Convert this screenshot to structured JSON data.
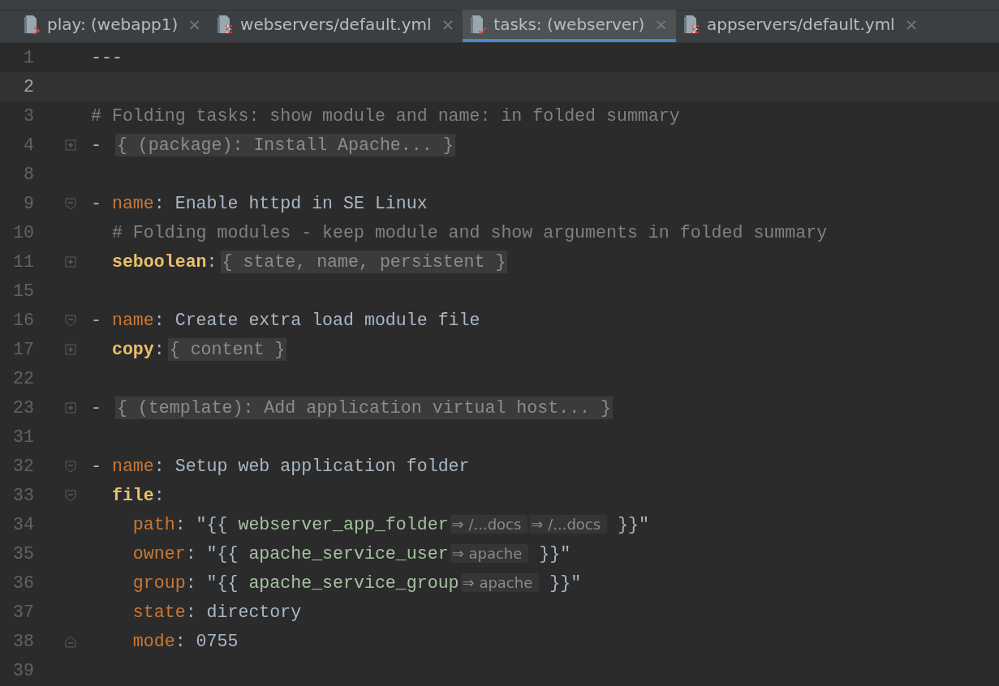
{
  "tabs": [
    {
      "label": "play: (webapp1)",
      "kind": "playbook",
      "close": "×",
      "selected": false
    },
    {
      "label": "webservers/default.yml",
      "kind": "vars",
      "close": "×",
      "selected": false
    },
    {
      "label": "tasks: (webserver)",
      "kind": "tasks",
      "close": "×",
      "selected": true
    },
    {
      "label": "appservers/default.yml",
      "kind": "vars",
      "close": "×",
      "selected": false
    }
  ],
  "editor": {
    "lines": [
      {
        "number": "1",
        "kind": "plain",
        "current": false,
        "tokens": [
          {
            "kind": "punct",
            "text": "---"
          }
        ]
      },
      {
        "number": "2",
        "kind": "plain",
        "current": true
      },
      {
        "number": "3",
        "kind": "plain",
        "current": false,
        "tokens": [
          {
            "kind": "comment",
            "text": "# Folding tasks: show module and name: in folded summary"
          }
        ]
      },
      {
        "number": "4",
        "kind": "collapsed",
        "current": false,
        "tokens": [
          {
            "kind": "punct",
            "text": "- "
          },
          {
            "kind": "folded",
            "text": "{ (package): Install Apache... }"
          }
        ]
      },
      {
        "number": "8",
        "kind": "plain",
        "current": false
      },
      {
        "number": "9",
        "kind": "region-start",
        "current": false,
        "tokens": [
          {
            "kind": "punct",
            "text": "- "
          },
          {
            "kind": "key",
            "text": "name"
          },
          {
            "kind": "punct",
            "text": ": "
          },
          {
            "kind": "value",
            "text": "Enable httpd in SE Linux"
          }
        ]
      },
      {
        "number": "10",
        "kind": "plain",
        "current": false,
        "tokens": [
          {
            "kind": "comment",
            "text": "  # Folding modules - keep module and show arguments in folded summary"
          }
        ]
      },
      {
        "number": "11",
        "kind": "collapsed",
        "current": false,
        "tokens": [
          {
            "kind": "module",
            "text": "  seboolean"
          },
          {
            "kind": "punct",
            "text": ":"
          },
          {
            "kind": "folded",
            "text": "{ state, name, persistent }"
          }
        ]
      },
      {
        "number": "15",
        "kind": "plain",
        "current": false
      },
      {
        "number": "16",
        "kind": "region-start",
        "current": false,
        "tokens": [
          {
            "kind": "punct",
            "text": "- "
          },
          {
            "kind": "key",
            "text": "name"
          },
          {
            "kind": "punct",
            "text": ": "
          },
          {
            "kind": "value",
            "text": "Create extra load module file"
          }
        ]
      },
      {
        "number": "17",
        "kind": "collapsed",
        "current": false,
        "tokens": [
          {
            "kind": "module",
            "text": "  copy"
          },
          {
            "kind": "punct",
            "text": ":"
          },
          {
            "kind": "folded",
            "text": "{ content }"
          }
        ]
      },
      {
        "number": "22",
        "kind": "plain",
        "current": false
      },
      {
        "number": "23",
        "kind": "collapsed",
        "current": false,
        "tokens": [
          {
            "kind": "punct",
            "text": "- "
          },
          {
            "kind": "folded",
            "text": "{ (template): Add application virtual host... }"
          }
        ]
      },
      {
        "number": "31",
        "kind": "plain",
        "current": false
      },
      {
        "number": "32",
        "kind": "region-start",
        "current": false,
        "tokens": [
          {
            "kind": "punct",
            "text": "- "
          },
          {
            "kind": "key",
            "text": "name"
          },
          {
            "kind": "punct",
            "text": ": "
          },
          {
            "kind": "value",
            "text": "Setup web application folder"
          }
        ]
      },
      {
        "number": "33",
        "kind": "region-start",
        "current": false,
        "tokens": [
          {
            "kind": "module",
            "text": "  file"
          },
          {
            "kind": "punct",
            "text": ":"
          }
        ]
      },
      {
        "number": "34",
        "kind": "plain",
        "current": false,
        "tokens": [
          {
            "kind": "key",
            "text": "    path"
          },
          {
            "kind": "punct",
            "text": ": \"{{ "
          },
          {
            "kind": "variable",
            "text": "webserver_app_folder"
          },
          {
            "kind": "hint",
            "text": "⇒ /...docs"
          },
          {
            "kind": "hint",
            "text": "⇒ /...docs"
          },
          {
            "kind": "punct",
            "text": " }}\""
          }
        ]
      },
      {
        "number": "35",
        "kind": "plain",
        "current": false,
        "tokens": [
          {
            "kind": "key",
            "text": "    owner"
          },
          {
            "kind": "punct",
            "text": ": \"{{ "
          },
          {
            "kind": "variable",
            "text": "apache_service_user"
          },
          {
            "kind": "hint",
            "text": "⇒ apache"
          },
          {
            "kind": "punct",
            "text": " }}\""
          }
        ]
      },
      {
        "number": "36",
        "kind": "plain",
        "current": false,
        "tokens": [
          {
            "kind": "key",
            "text": "    group"
          },
          {
            "kind": "punct",
            "text": ": \"{{ "
          },
          {
            "kind": "variable",
            "text": "apache_service_group"
          },
          {
            "kind": "hint",
            "text": "⇒ apache"
          },
          {
            "kind": "punct",
            "text": " }}\""
          }
        ]
      },
      {
        "number": "37",
        "kind": "plain",
        "current": false,
        "tokens": [
          {
            "kind": "key",
            "text": "    state"
          },
          {
            "kind": "punct",
            "text": ": "
          },
          {
            "kind": "value",
            "text": "directory"
          }
        ]
      },
      {
        "number": "38",
        "kind": "region-end",
        "current": false,
        "tokens": [
          {
            "kind": "key",
            "text": "    mode"
          },
          {
            "kind": "punct",
            "text": ": "
          },
          {
            "kind": "value",
            "text": "0755"
          }
        ]
      },
      {
        "number": "39",
        "kind": "plain",
        "current": false
      }
    ]
  }
}
